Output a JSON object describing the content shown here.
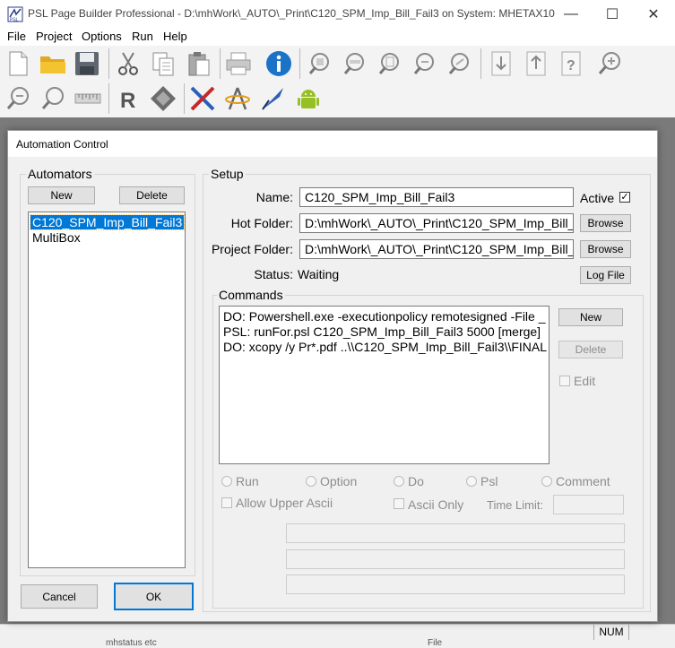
{
  "window": {
    "title": "PSL Page Builder Professional - D:\\mhWork\\_AUTO\\_Print\\C120_SPM_Imp_Bill_Fail3 on System: MHETAX10",
    "controls": {
      "minimize": "—",
      "maximize": "☐",
      "close": "✕"
    }
  },
  "menu": [
    "File",
    "Project",
    "Options",
    "Run",
    "Help"
  ],
  "toolbar": {
    "row1": [
      "new-file-icon",
      "open-folder-icon",
      "save-icon",
      "cut-icon",
      "copy-icon",
      "paste-icon",
      "print-icon",
      "info-icon",
      "zoom-page-icon",
      "zoom-width-icon",
      "zoom-fit-icon",
      "zoom-area-icon",
      "zoom-custom-icon",
      "move-down-icon",
      "move-up-icon",
      "help-icon",
      "zoom-in-icon"
    ],
    "row2": [
      "zoom-out-icon",
      "zoom-reset-icon",
      "ruler-icon",
      "r-icon",
      "tag-icon",
      "tools-icon",
      "compass-icon",
      "pen-icon",
      "android-icon"
    ],
    "info_color": "#1a73c7",
    "folder_color": "#f4c430"
  },
  "dialog": {
    "title": "Automation Control",
    "automators": {
      "label": "Automators",
      "new_label": "New",
      "delete_label": "Delete",
      "items": [
        "C120_SPM_Imp_Bill_Fail3",
        "MultiBox"
      ],
      "selected_index": 0
    },
    "setup": {
      "label": "Setup",
      "name_label": "Name:",
      "name_value": "C120_SPM_Imp_Bill_Fail3",
      "active_label": "Active",
      "active_checked": true,
      "hot_folder_label": "Hot Folder:",
      "hot_folder_value": "D:\\mhWork\\_AUTO\\_Print\\C120_SPM_Imp_Bill_",
      "project_folder_label": "Project Folder:",
      "project_folder_value": "D:\\mhWork\\_AUTO\\_Print\\C120_SPM_Imp_Bill_",
      "browse_label": "Browse",
      "status_label": "Status:",
      "status_value": "Waiting",
      "log_file_label": "Log File"
    },
    "commands": {
      "label": "Commands",
      "lines": [
        "DO: Powershell.exe -executionpolicy remotesigned -File _",
        "PSL: runFor.psl C120_SPM_Imp_Bill_Fail3 5000 [merge]",
        "DO: xcopy /y Pr*.pdf ..\\\\C120_SPM_Imp_Bill_Fail3\\\\FINAL"
      ],
      "new_label": "New",
      "delete_label": "Delete",
      "edit_label": "Edit",
      "radio_options": [
        "Run",
        "Option",
        "Do",
        "Psl",
        "Comment"
      ],
      "allow_upper_ascii_label": "Allow Upper Ascii",
      "ascii_only_label": "Ascii Only",
      "time_limit_label": "Time Limit:",
      "time_limit_value": ""
    },
    "cancel_label": "Cancel",
    "ok_label": "OK",
    "accent_color": "#0078d7"
  },
  "statusbar": {
    "num_label": "NUM",
    "ghost_left": "mhstatus etc",
    "ghost_right": "File"
  }
}
